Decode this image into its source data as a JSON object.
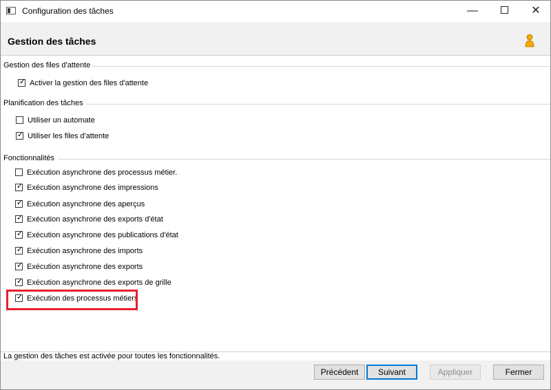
{
  "window": {
    "title": "Configuration des tâches",
    "minimize_glyph": "—",
    "close_glyph": "✕"
  },
  "header": {
    "title": "Gestion des tâches",
    "icon": "user-icon"
  },
  "groups": {
    "queue": {
      "label": "Gestion des files d'attente",
      "items": [
        {
          "label": "Activer la gestion des files d'attente",
          "checked": true
        }
      ]
    },
    "planning": {
      "label": "Planification des tâches",
      "items": [
        {
          "label": "Utiliser un automate",
          "checked": false
        },
        {
          "label": "Utiliser les files d'attente",
          "checked": true
        }
      ]
    },
    "features": {
      "label": "Fonctionnalités",
      "items": [
        {
          "label": "Exécution asynchrone des processus métier.",
          "checked": false
        },
        {
          "label": "Exécution asynchrone des impressions",
          "checked": true
        },
        {
          "label": "Exécution asynchrone des aperçus",
          "checked": true
        },
        {
          "label": "Exécution asynchrone des exports d'état",
          "checked": true
        },
        {
          "label": "Exécution asynchrone des publications d'état",
          "checked": true
        },
        {
          "label": "Exécution asynchrone des imports",
          "checked": true
        },
        {
          "label": "Exécution asynchrone des exports",
          "checked": true
        },
        {
          "label": "Exécution asynchrone des exports de grille",
          "checked": true
        },
        {
          "label": "Exécution des processus métiers",
          "checked": true
        }
      ]
    }
  },
  "status": {
    "text": "La gestion des tâches est activée pour toutes les fonctionnalités."
  },
  "buttons": {
    "previous": "Précédent",
    "next": "Suivant",
    "apply": "Appliquer",
    "close": "Fermer"
  },
  "colors": {
    "highlight": "#e8202a",
    "default_button_border": "#0078d7",
    "header_bg": "#f1f1f1"
  }
}
